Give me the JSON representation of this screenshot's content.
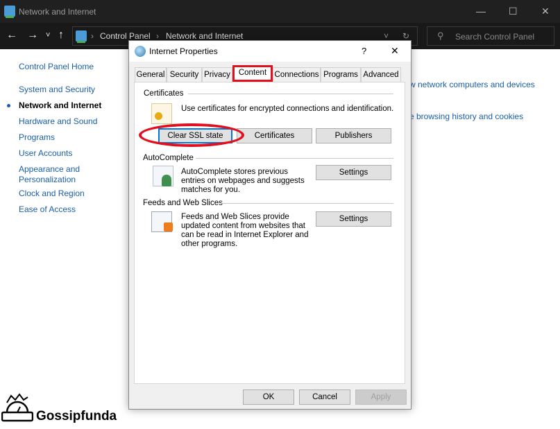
{
  "window": {
    "title": "Network and Internet",
    "minimize": "—",
    "maximize": "☐",
    "close": "✕"
  },
  "address": {
    "back": "←",
    "forward": "→",
    "recent": "˅",
    "up": "↑",
    "crumbs": [
      "Control Panel",
      "Network and Internet"
    ],
    "sep": "›",
    "dropdown": "˅",
    "refresh": "↻"
  },
  "search": {
    "placeholder": "Search Control Panel",
    "icon": "search-icon"
  },
  "sidebar": {
    "items": [
      {
        "label": "Control Panel Home"
      },
      {
        "label": "System and Security"
      },
      {
        "label": "Network and Internet",
        "current": true
      },
      {
        "label": "Hardware and Sound"
      },
      {
        "label": "Programs"
      },
      {
        "label": "User Accounts"
      },
      {
        "label": "Appearance and Personalization"
      },
      {
        "label": "Clock and Region"
      },
      {
        "label": "Ease of Access"
      }
    ]
  },
  "main": {
    "links": [
      "w network computers and devices",
      "e browsing history and cookies"
    ]
  },
  "dialog": {
    "title": "Internet Properties",
    "help": "?",
    "close": "✕",
    "tabs": [
      {
        "label": "General"
      },
      {
        "label": "Security"
      },
      {
        "label": "Privacy"
      },
      {
        "label": "Content",
        "active": true
      },
      {
        "label": "Connections"
      },
      {
        "label": "Programs"
      },
      {
        "label": "Advanced"
      }
    ],
    "certificates": {
      "heading": "Certificates",
      "text": "Use certificates for encrypted connections and identification.",
      "buttons": [
        "Clear SSL state",
        "Certificates",
        "Publishers"
      ]
    },
    "autocomplete": {
      "heading": "AutoComplete",
      "text": "AutoComplete stores previous entries on webpages and suggests matches for you.",
      "button": "Settings"
    },
    "feeds": {
      "heading": "Feeds and Web Slices",
      "text": "Feeds and Web Slices provide updated content from websites that can be read in Internet Explorer and other programs.",
      "button": "Settings"
    },
    "footer": {
      "ok": "OK",
      "cancel": "Cancel",
      "apply": "Apply"
    }
  },
  "highlight_color": "#e0101e",
  "watermark": {
    "text": "Gossipfunda"
  }
}
